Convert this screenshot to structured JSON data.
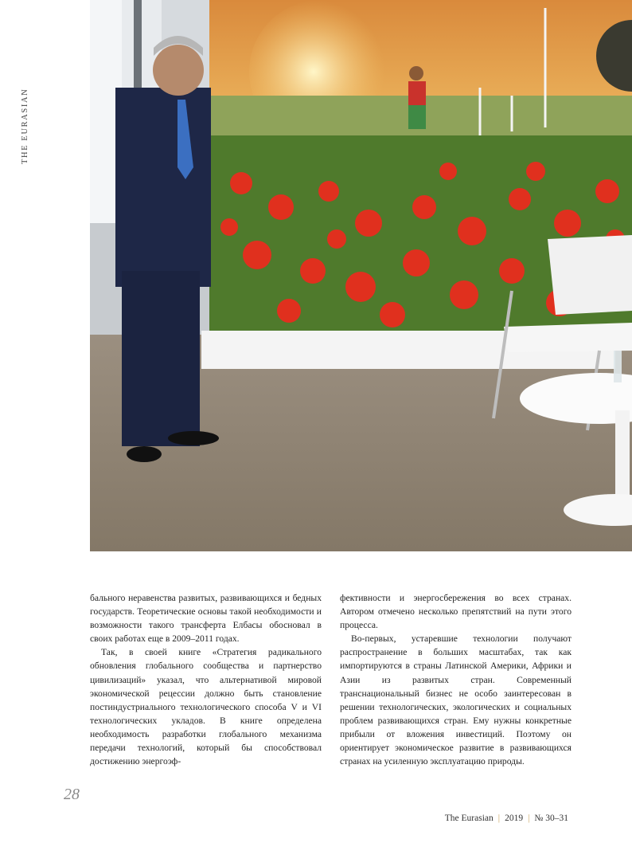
{
  "brand_vertical": "THE EURASIAN",
  "photo": {
    "description_icon": "photo-speaker-in-front-of-poppy-field-mural"
  },
  "body": {
    "left_column": [
      "бального неравенства развитых, развивающихся и бедных государств. Теоретические основы такой необходимости и возможности такого трансферта Елбасы обосновал в своих работах еще в 2009–2011 годах.",
      "Так, в своей книге «Стратегия радикального обновления глобального сообщества и партнерство цивилизаций» указал, что альтернативой мировой экономической рецессии должно быть становление постиндустриального технологического способа V и VI технологических укладов. В книге определена необходимость разработки глобального механизма передачи технологий, который бы способствовал достижению энергоэф-"
    ],
    "right_column": [
      "фективности и энергосбережения во всех странах. Автором отмечено несколько препятствий на пути этого процесса.",
      "Во-первых, устаревшие технологии получают распространение в больших масштабах, так как импортируются в страны Латинской Америки, Африки и Азии из развитых стран. Современный транснациональный бизнес не особо заинтересован в решении технологических, экологических и социальных проблем развивающихся стран. Ему нужны конкретные прибыли от вложения инвестиций. Поэтому он ориентирует экономическое развитие в развивающихся странах на усиленную эксплуатацию природы."
    ]
  },
  "page_number": "28",
  "footer": {
    "magazine": "The Eurasian",
    "separator": "|",
    "year": "2019",
    "issue": "№ 30–31"
  }
}
